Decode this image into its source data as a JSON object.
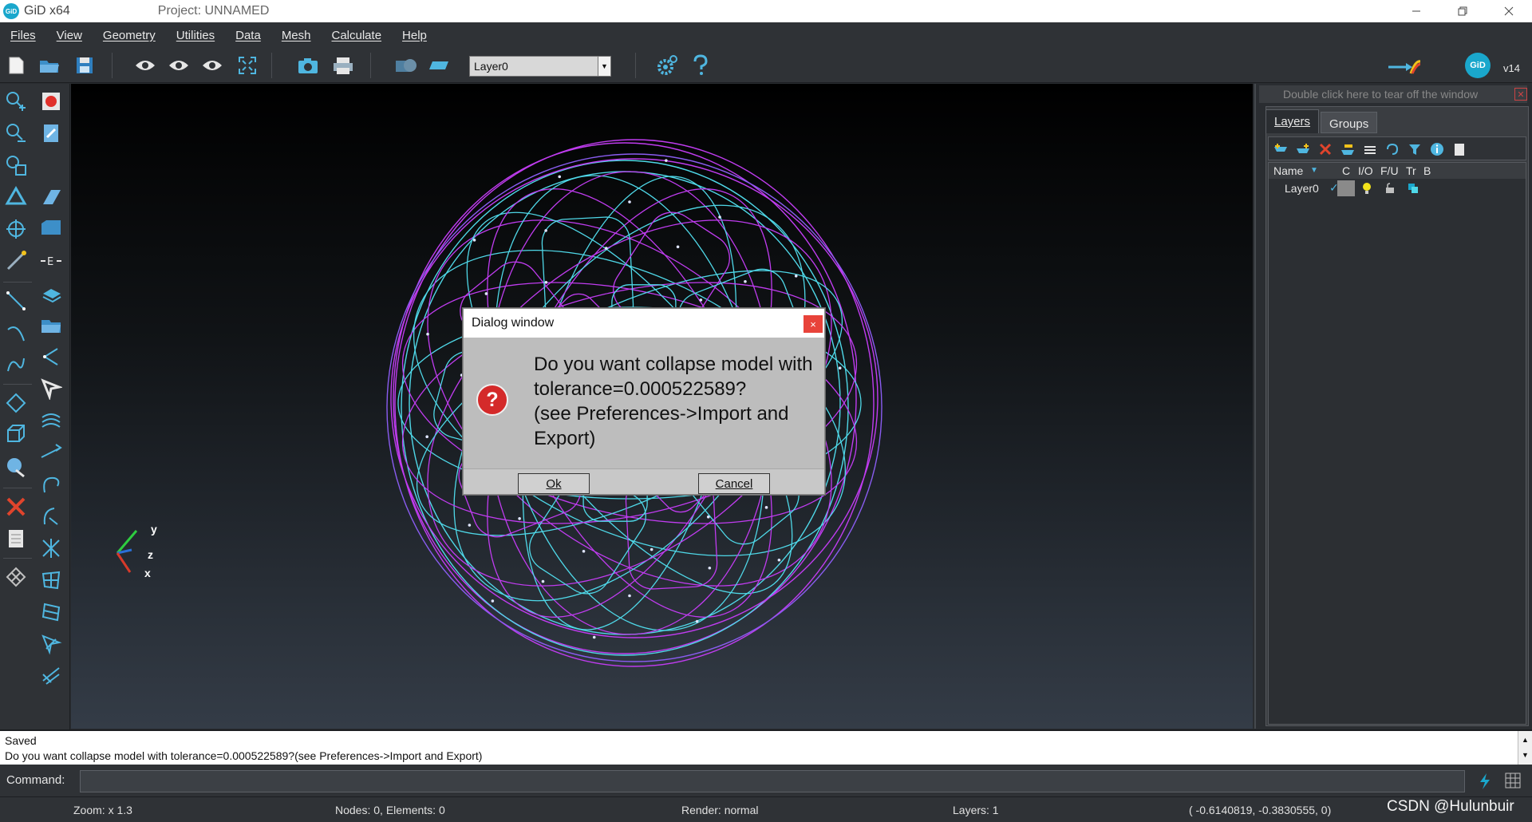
{
  "titlebar": {
    "app_name": "GiD x64",
    "project": "Project: UNNAMED",
    "logo_text": "GiD"
  },
  "menu": [
    "Files",
    "View",
    "Geometry",
    "Utilities",
    "Data",
    "Mesh",
    "Calculate",
    "Help"
  ],
  "toolbar": {
    "layer_select_value": "Layer0",
    "version": "v14",
    "gid_logo": "GiD"
  },
  "right_panel": {
    "tearoff_text": "Double click here to tear off the window",
    "tabs": [
      "Layers",
      "Groups"
    ],
    "columns": [
      "Name",
      "C",
      "I/O",
      "F/U",
      "Tr",
      "B"
    ],
    "rows": [
      {
        "name": "Layer0"
      }
    ]
  },
  "dialog": {
    "title": "Dialog window",
    "message": "Do you want collapse model with tolerance=0.000522589?\n(see Preferences->Import and Export)",
    "message_line1": "Do you want collapse model with",
    "message_line2": "tolerance=0.000522589?",
    "message_line3": "(see Preferences->Import and",
    "message_line4": "Export)",
    "ok_label": "Ok",
    "cancel_label": "Cancel",
    "close_label": "×"
  },
  "output": {
    "line1": "Saved",
    "line2": "Do you want collapse model with tolerance=0.000522589?(see Preferences->Import and Export)"
  },
  "command": {
    "label": "Command:"
  },
  "status": {
    "zoom": "Zoom: x 1.3",
    "nodes": "Nodes: 0, Elements: 0",
    "render": "Render: normal",
    "layers": "Layers: 1",
    "coords": "( -0.6140819, -0.3830555,  0)"
  },
  "axes": {
    "y": "y",
    "z": "z",
    "x": "x"
  },
  "watermark": "CSDN @Hulunbuir",
  "colors": {
    "magenta": "#c03cf0",
    "cyan": "#4fd8e8",
    "accent": "#1aa7cc",
    "dialog_error": "#d42a2a"
  }
}
